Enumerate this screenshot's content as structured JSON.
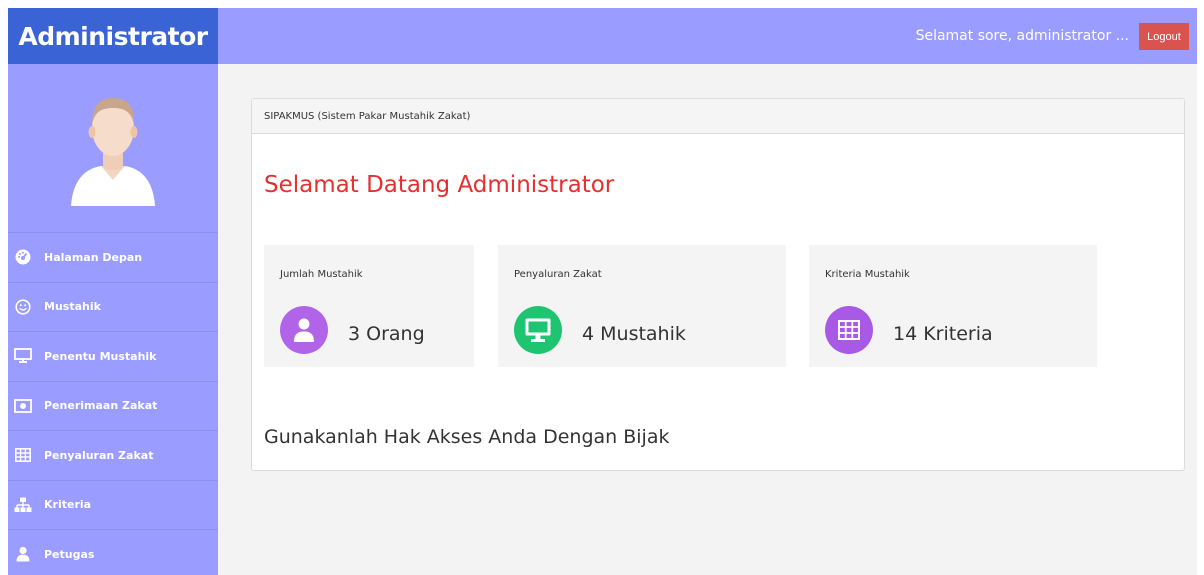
{
  "header": {
    "brand": "Administrator",
    "greeting": "Selamat sore, administrator ...",
    "logout_label": "Logout"
  },
  "sidebar": {
    "items": [
      {
        "label": "Halaman Depan",
        "icon": "dashboard-icon"
      },
      {
        "label": "Mustahik",
        "icon": "smiley-icon"
      },
      {
        "label": "Penentu Mustahik",
        "icon": "monitor-icon"
      },
      {
        "label": "Penerimaan Zakat",
        "icon": "money-icon"
      },
      {
        "label": "Penyaluran Zakat",
        "icon": "table-icon"
      },
      {
        "label": "Kriteria",
        "icon": "sitemap-icon"
      },
      {
        "label": "Petugas",
        "icon": "user-icon"
      }
    ]
  },
  "panel": {
    "heading": "SIPAKMUS (Sistem Pakar Mustahik Zakat)",
    "welcome": "Selamat Datang Administrator",
    "footer": "Gunakanlah Hak Akses Anda Dengan Bijak"
  },
  "cards": [
    {
      "title": "Jumlah Mustahik",
      "value": "3 Orang",
      "icon": "user-icon",
      "color": "#b264e8"
    },
    {
      "title": "Penyaluran Zakat",
      "value": "4 Mustahik",
      "icon": "monitor-icon",
      "color": "#1ec470"
    },
    {
      "title": "Kriteria Mustahik",
      "value": "14 Kriteria",
      "icon": "table-icon",
      "color": "#a85ae6"
    }
  ],
  "colors": {
    "topbar": "#9a9cff",
    "brand": "#3a63d6",
    "logout": "#d9534f",
    "welcome": "#e53030"
  }
}
